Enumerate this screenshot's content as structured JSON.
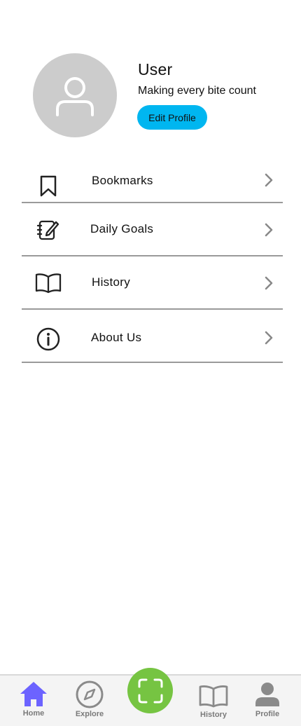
{
  "profile": {
    "name": "User",
    "tagline": "Making every bite count",
    "edit_button_label": "Edit Profile"
  },
  "menu": {
    "items": [
      {
        "label": "Bookmarks",
        "icon": "bookmark-icon"
      },
      {
        "label": "Daily Goals",
        "icon": "edit-note-icon"
      },
      {
        "label": "History",
        "icon": "book-icon"
      },
      {
        "label": "About Us",
        "icon": "info-icon"
      }
    ]
  },
  "bottom_nav": {
    "items": [
      {
        "label": "Home",
        "icon": "home-icon",
        "active": true
      },
      {
        "label": "Explore",
        "icon": "compass-icon",
        "active": false
      },
      {
        "label": "History",
        "icon": "book-icon",
        "active": false
      },
      {
        "label": "Profile",
        "icon": "person-icon",
        "active": false
      }
    ],
    "scan_icon": "scan-icon"
  },
  "colors": {
    "accent_blue": "#00b6f0",
    "home_active": "#6c63ff",
    "scan_green": "#76c442",
    "avatar_bg": "#cccccc",
    "nav_inactive": "#8a8a8a"
  }
}
